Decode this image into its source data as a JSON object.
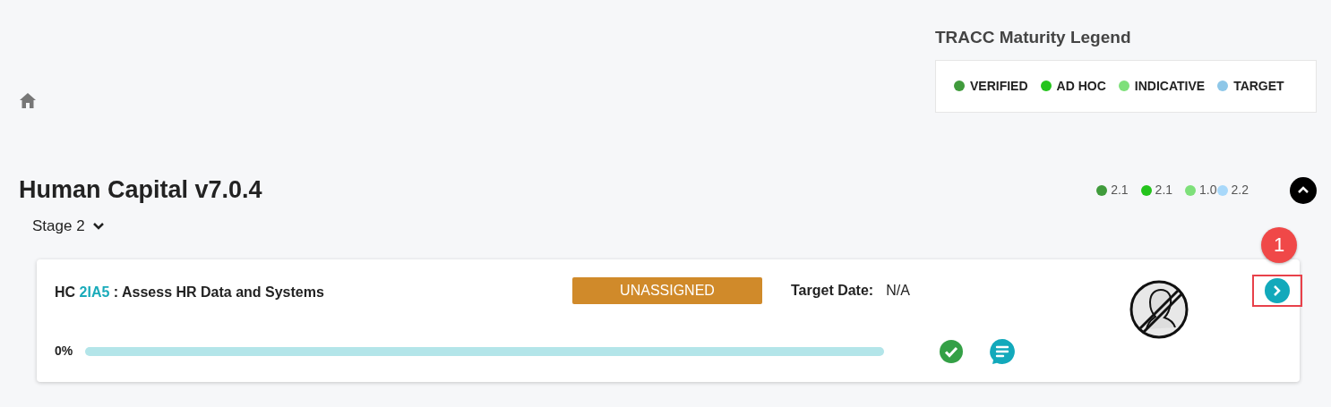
{
  "legend": {
    "title": "TRACC Maturity Legend",
    "items": [
      {
        "label": "VERIFIED",
        "color": "#409b3c"
      },
      {
        "label": "AD HOC",
        "color": "#24c41c"
      },
      {
        "label": "INDICATIVE",
        "color": "#7ee07a"
      },
      {
        "label": "TARGET",
        "color": "#8ec7e8"
      }
    ]
  },
  "module": {
    "title": "Human Capital v7.0.4",
    "scores": [
      {
        "value": "2.1",
        "color": "#409b3c"
      },
      {
        "value": "2.1",
        "color": "#24c41c"
      },
      {
        "value": "1.0",
        "color": "#7ee07a"
      },
      {
        "value": "2.2",
        "color": "#a8d8fa"
      }
    ]
  },
  "stage": {
    "label": "Stage 2",
    "expanded": true
  },
  "cards": [
    {
      "prefix": "HC",
      "code": "2IA5",
      "title": ": Assess HR Data and Systems",
      "status": "UNASSIGNED",
      "target_label": "Target Date:",
      "target_value": "N/A",
      "progress_text": "0%",
      "level": 0,
      "verified": true
    }
  ],
  "annotation": {
    "number": "1"
  }
}
